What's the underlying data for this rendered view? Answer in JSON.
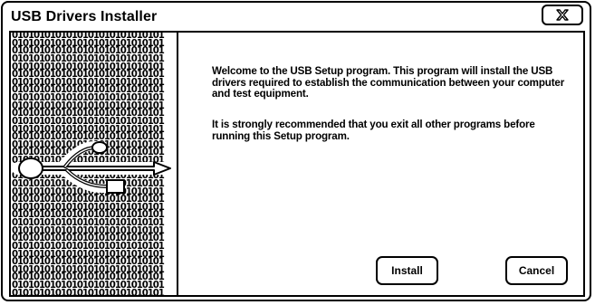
{
  "window": {
    "title": "USB Drivers Installer"
  },
  "side_panel": {
    "pattern_line": "0101010101010101010101010101",
    "icon": "usb-icon"
  },
  "content": {
    "welcome_text": "Welcome to the USB Setup program. This program will install the USB drivers required to establish the communication between your computer and test equipment.",
    "recommendation_text": "It is strongly recommended that you exit all other programs before running this Setup program."
  },
  "buttons": {
    "install_label": "Install",
    "cancel_label": "Cancel"
  },
  "colors": {
    "foreground": "#000000",
    "background": "#ffffff"
  }
}
